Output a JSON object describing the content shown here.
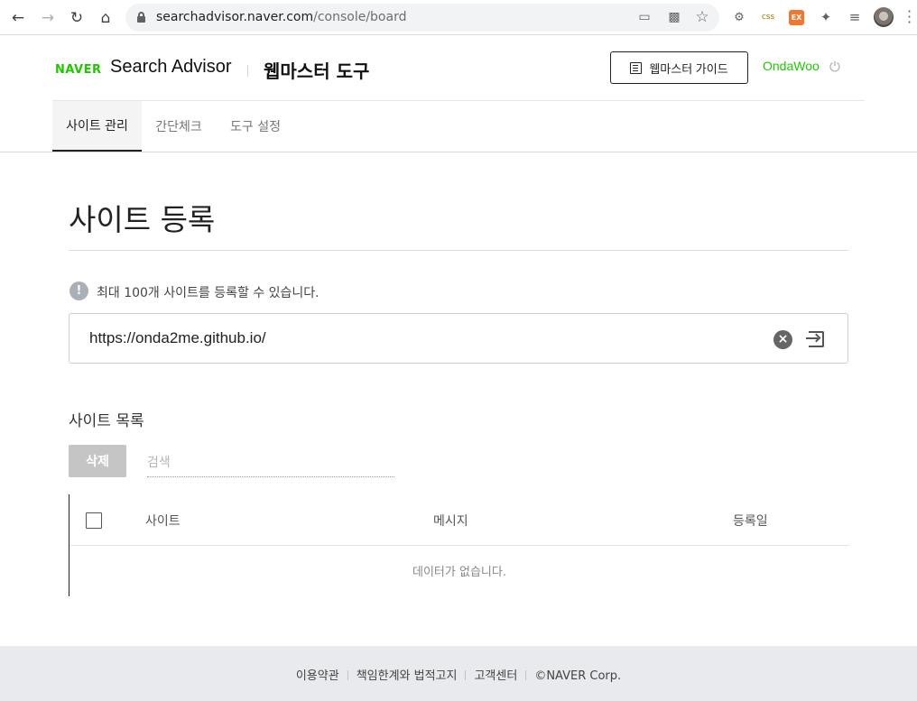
{
  "browser": {
    "url_host": "searchadvisor.naver.com",
    "url_path": "/console/board"
  },
  "header": {
    "logo": "NAVER",
    "title": "Search Advisor",
    "tool_title": "웹마스터 도구",
    "guide_button": "웹마스터 가이드",
    "user": "OndaWoo"
  },
  "tabs": [
    {
      "label": "사이트 관리",
      "active": true
    },
    {
      "label": "간단체크",
      "active": false
    },
    {
      "label": "도구 설정",
      "active": false
    }
  ],
  "main": {
    "title": "사이트 등록",
    "info": "최대 100개 사이트를 등록할 수 있습니다.",
    "url_value": "https://onda2me.github.io/",
    "list_title": "사이트 목록",
    "delete_button": "삭제",
    "search_placeholder": "검색",
    "columns": [
      "사이트",
      "메시지",
      "등록일"
    ],
    "empty_message": "데이터가 없습니다."
  },
  "footer": {
    "links": [
      "이용약관",
      "책임한계와 법적고지",
      "고객센터"
    ],
    "copyright": "©NAVER Corp."
  },
  "colors": {
    "brand": "#1ec800",
    "disabled_button": "#c5c5c5",
    "footer_bg": "#e9eaed"
  }
}
